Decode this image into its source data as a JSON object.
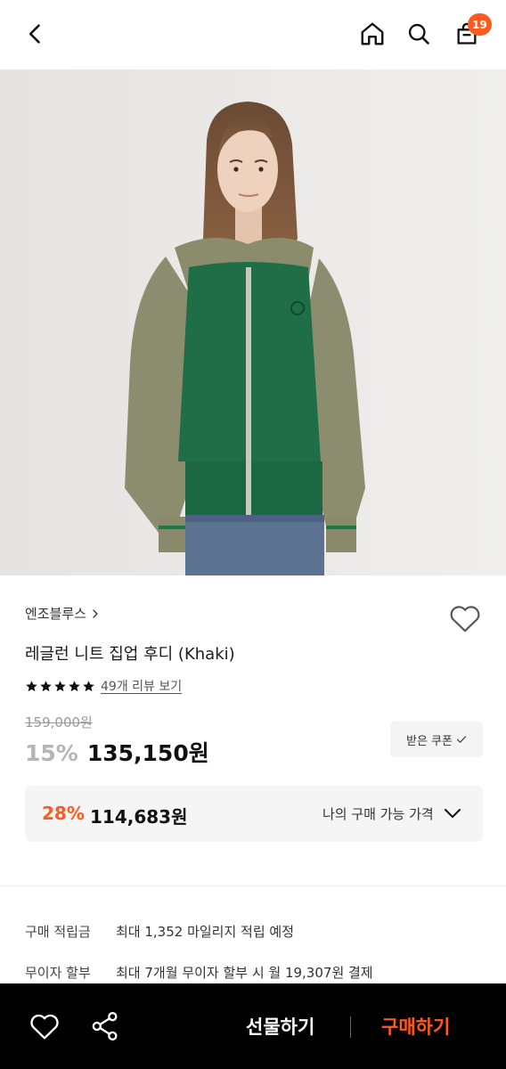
{
  "header": {
    "back_icon": "chevron-left-icon",
    "home_icon": "home-icon",
    "search_icon": "search-icon",
    "bag_icon": "shopping-bag-icon",
    "bag_count": "19",
    "badge_color": "#ff5a1f"
  },
  "product": {
    "brand": "엔조블루스",
    "name": "레글런 니트 집업 후디 (Khaki)",
    "review_link": "49개 리뷰 보기",
    "rating_stars": 5,
    "original_price": "159,000원",
    "discount_rate": "15%",
    "price": "135,150원",
    "coupon_button": "받은 쿠폰"
  },
  "my_price": {
    "rate": "28%",
    "amount": "114,683원",
    "label": "나의 구매 가능 가격"
  },
  "info": {
    "points_label": "구매 적립금",
    "points_value": "최대 1,352 마일리지 적립 예정",
    "installment_label": "무이자 할부",
    "installment_value": "최대 7개월 무이자 할부 시 월 19,307원 결제"
  },
  "bottom_bar": {
    "gift_label": "선물하기",
    "buy_label": "구매하기",
    "accent": "#ff5a1f"
  }
}
